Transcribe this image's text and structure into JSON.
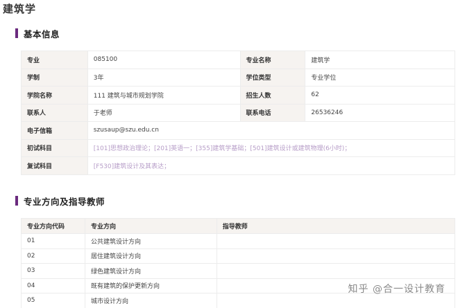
{
  "page_title": "建筑学",
  "basic_info": {
    "heading": "基本信息",
    "rows": [
      {
        "l1": "专业",
        "v1": "085100",
        "l2": "专业名称",
        "v2": "建筑学"
      },
      {
        "l1": "学制",
        "v1": "3年",
        "l2": "学位类型",
        "v2": "专业学位"
      },
      {
        "l1": "学院名称",
        "v1": "111 建筑与城市规划学院",
        "l2": "招生人数",
        "v2": "62"
      },
      {
        "l1": "联系人",
        "v1": "于老师",
        "l2": "联系电话",
        "v2": "26536246"
      }
    ],
    "email_label": "电子信箱",
    "email_value": "szusaup@szu.edu.cn",
    "initial_label": "初试科目",
    "initial_value": "[101]思想政治理论；[201]英语一；[355]建筑学基础；[501]建筑设计或建筑物理(6小时)；",
    "retest_label": "复试科目",
    "retest_value": "[F530]建筑设计及其表达；"
  },
  "directions": {
    "heading": "专业方向及指导教师",
    "headers": [
      "专业方向代码",
      "专业方向",
      "指导教师"
    ],
    "rows": [
      {
        "code": "01",
        "name": "公共建筑设计方向",
        "teacher": ""
      },
      {
        "code": "02",
        "name": "居住建筑设计方向",
        "teacher": ""
      },
      {
        "code": "03",
        "name": "绿色建筑设计方向",
        "teacher": ""
      },
      {
        "code": "04",
        "name": "既有建筑的保护更新方向",
        "teacher": ""
      },
      {
        "code": "05",
        "name": "城市设计方向",
        "teacher": ""
      }
    ]
  },
  "watermark": "知乎 @合一设计教育",
  "colors": {
    "accent": "#6a2a7e",
    "label_bg": "#f6f3f0",
    "link": "#b69cc7"
  }
}
